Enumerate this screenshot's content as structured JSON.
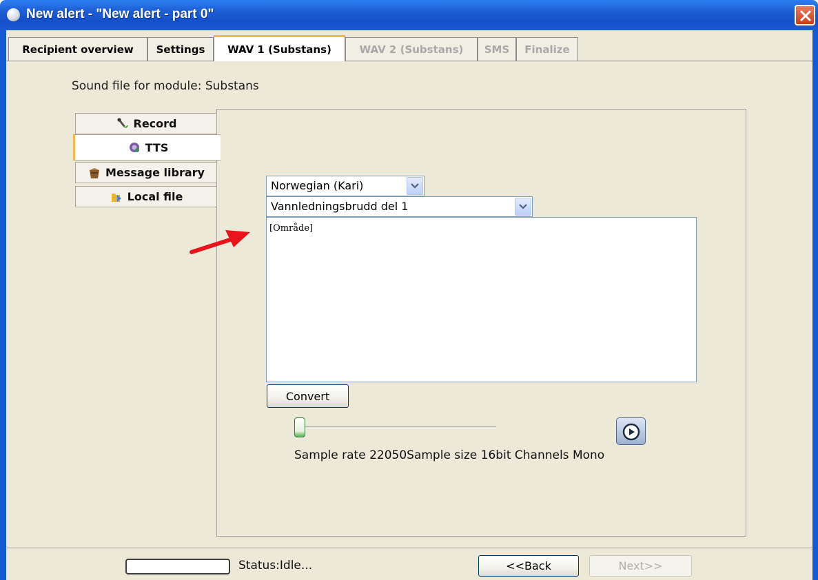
{
  "window": {
    "title": "New alert - \"New alert - part 0\"",
    "title_color": "#1458d2"
  },
  "tabs": [
    {
      "label": "Recipient overview",
      "state": "normal"
    },
    {
      "label": "Settings",
      "state": "normal"
    },
    {
      "label": "WAV 1 (Substans)",
      "state": "active"
    },
    {
      "label": "WAV 2 (Substans)",
      "state": "disabled"
    },
    {
      "label": "SMS",
      "state": "disabled"
    },
    {
      "label": "Finalize",
      "state": "disabled"
    }
  ],
  "module_label": "Sound file for module: Substans",
  "side_tabs": [
    {
      "label": "Record",
      "icon": "microphone-icon",
      "state": "normal"
    },
    {
      "label": "TTS",
      "icon": "tts-speaker-icon",
      "state": "active"
    },
    {
      "label": "Message library",
      "icon": "library-bag-icon",
      "state": "normal"
    },
    {
      "label": "Local file",
      "icon": "folder-icon",
      "state": "normal"
    }
  ],
  "tts": {
    "voice_selected": "Norwegian (Kari)",
    "message_selected": "Vannledningsbrudd del 1",
    "text_value": "[Område]",
    "convert_label": "Convert",
    "playback_position": 0,
    "sample_info": "Sample rate 22050Sample size 16bit Channels Mono"
  },
  "footer": {
    "status": "Status:Idle...",
    "back_label": "<<Back",
    "next_label": "Next>>",
    "next_enabled": false
  },
  "annotation": {
    "arrow_color": "#e8141b"
  }
}
